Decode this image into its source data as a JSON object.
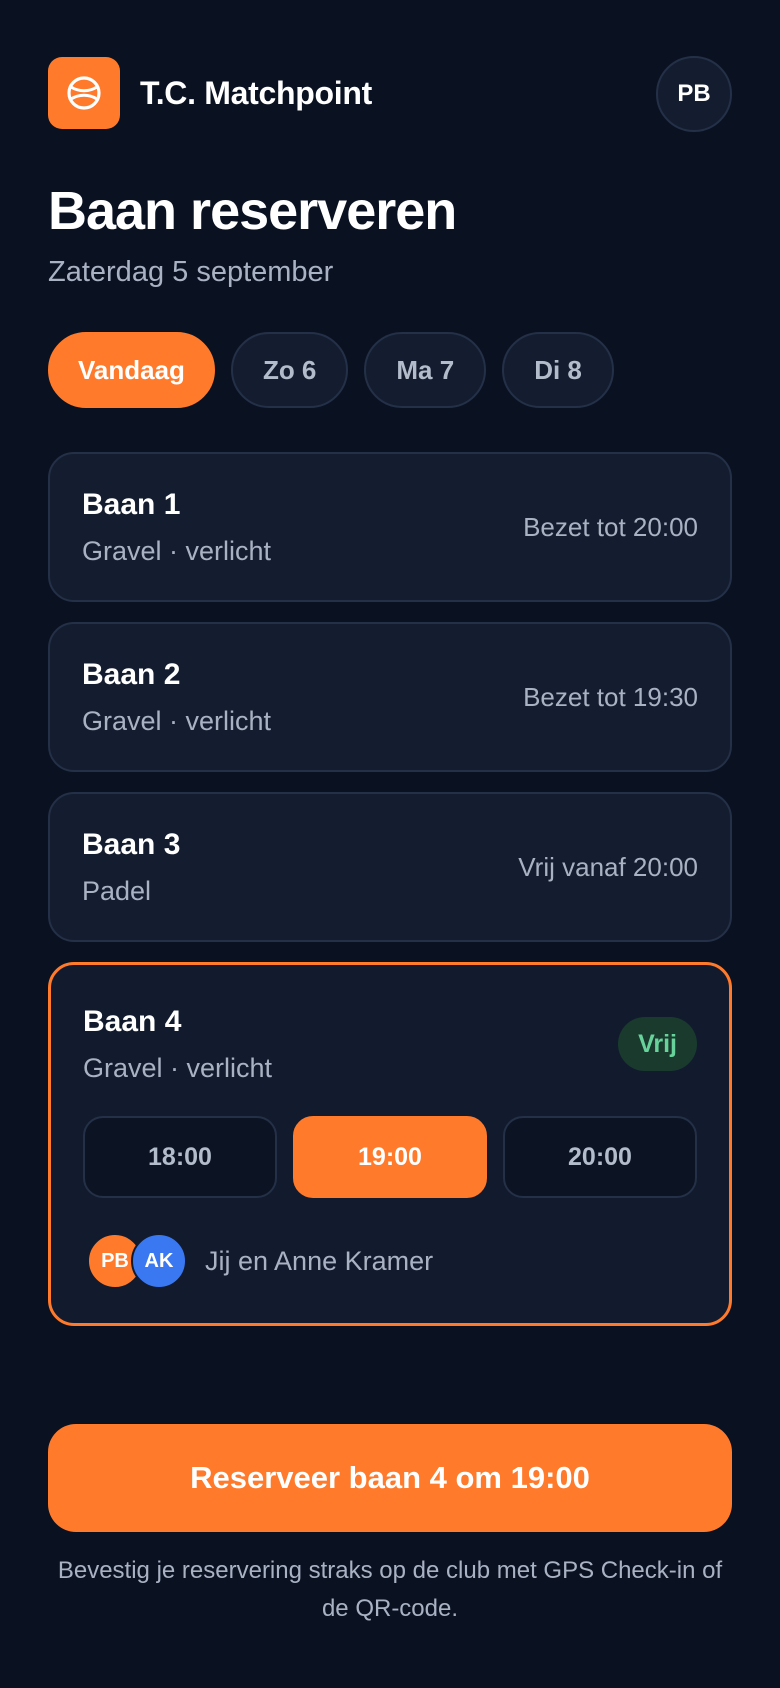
{
  "header": {
    "brand": "T.C. Matchpoint",
    "user_initials": "PB",
    "logo_icon": "tennis-ball-icon",
    "accent": "#ff7a2a"
  },
  "page": {
    "title": "Baan reserveren",
    "date": "Zaterdag 5 september"
  },
  "days": [
    {
      "label": "Vandaag",
      "active": true
    },
    {
      "label": "Zo 6",
      "active": false
    },
    {
      "label": "Ma 7",
      "active": false
    },
    {
      "label": "Di 8",
      "active": false
    }
  ],
  "courts": [
    {
      "name": "Baan 1",
      "meta": "Gravel · verlicht",
      "status": "Bezet tot 20:00"
    },
    {
      "name": "Baan 2",
      "meta": "Gravel · verlicht",
      "status": "Bezet tot 19:30"
    },
    {
      "name": "Baan 3",
      "meta": "Padel",
      "status": "Vrij vanaf 20:00"
    }
  ],
  "selected_court": {
    "name": "Baan 4",
    "meta": "Gravel · verlicht",
    "badge": "Vrij",
    "badge_color": "#67d39a",
    "slots": [
      "18:00",
      "19:00",
      "20:00"
    ],
    "active_slot": "19:00",
    "players": [
      {
        "initials": "PB",
        "color": "#ff7a2a"
      },
      {
        "initials": "AK",
        "color": "#3a78f2"
      }
    ],
    "players_label": "Jij en Anne Kramer"
  },
  "cta": {
    "label": "Reserveer baan 4 om 19:00"
  },
  "note": "Bevestig je reservering straks op de club met GPS Check-in of de QR-code."
}
